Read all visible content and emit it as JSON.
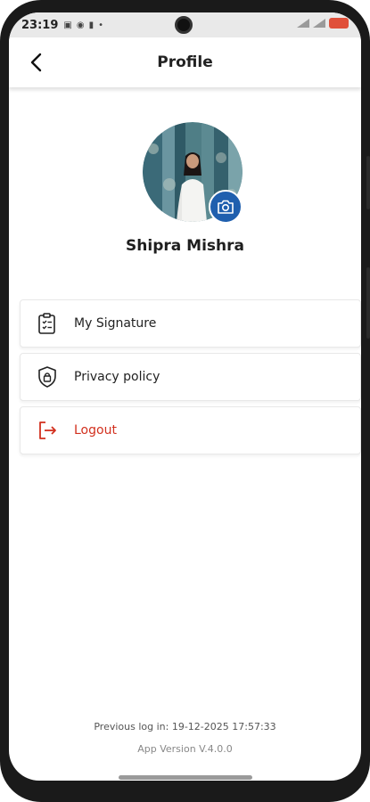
{
  "status_bar": {
    "time": "23:19"
  },
  "header": {
    "title": "Profile"
  },
  "profile": {
    "name": "Shipra Mishra"
  },
  "menu": {
    "items": [
      {
        "label": "My Signature",
        "icon": "signature-clipboard-icon"
      },
      {
        "label": "Privacy policy",
        "icon": "shield-lock-icon"
      },
      {
        "label": "Logout",
        "icon": "logout-icon"
      }
    ]
  },
  "footer": {
    "previous_login": "Previous log in: 19-12-2025 17:57:33",
    "app_version": "App Version V.4.0.0"
  },
  "colors": {
    "accent": "#1f5fae",
    "logout": "#d2301e"
  }
}
